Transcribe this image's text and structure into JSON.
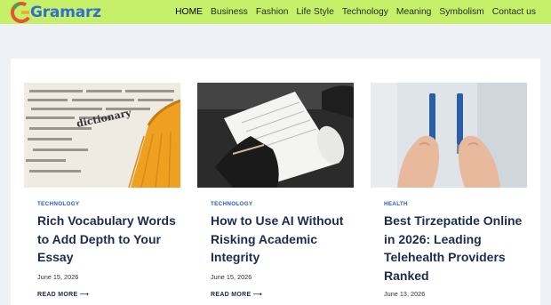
{
  "brand": {
    "name": "Gramarz",
    "accent": "#2f6fd2",
    "header_bg": "#c7f06a"
  },
  "nav": {
    "items": [
      {
        "label": "HOME"
      },
      {
        "label": "Business"
      },
      {
        "label": "Fashion"
      },
      {
        "label": "Life Style"
      },
      {
        "label": "Technology"
      },
      {
        "label": "Meaning"
      },
      {
        "label": "Symbolism"
      },
      {
        "label": "Contact us"
      }
    ]
  },
  "posts": [
    {
      "category": "TECHNOLOGY",
      "title": "Rich Vocabulary Words to Add Depth to Your Essay",
      "date": "June 15, 2026",
      "read_more": "READ MORE"
    },
    {
      "category": "TECHNOLOGY",
      "title": "How to Use AI Without Risking Academic Integrity",
      "date": "June 15, 2026",
      "read_more": "READ MORE"
    },
    {
      "category": "HEALTH",
      "title": "Best Tirzepatide Online in 2026: Leading Telehealth Providers Ranked",
      "date": "June 13, 2026"
    }
  ]
}
